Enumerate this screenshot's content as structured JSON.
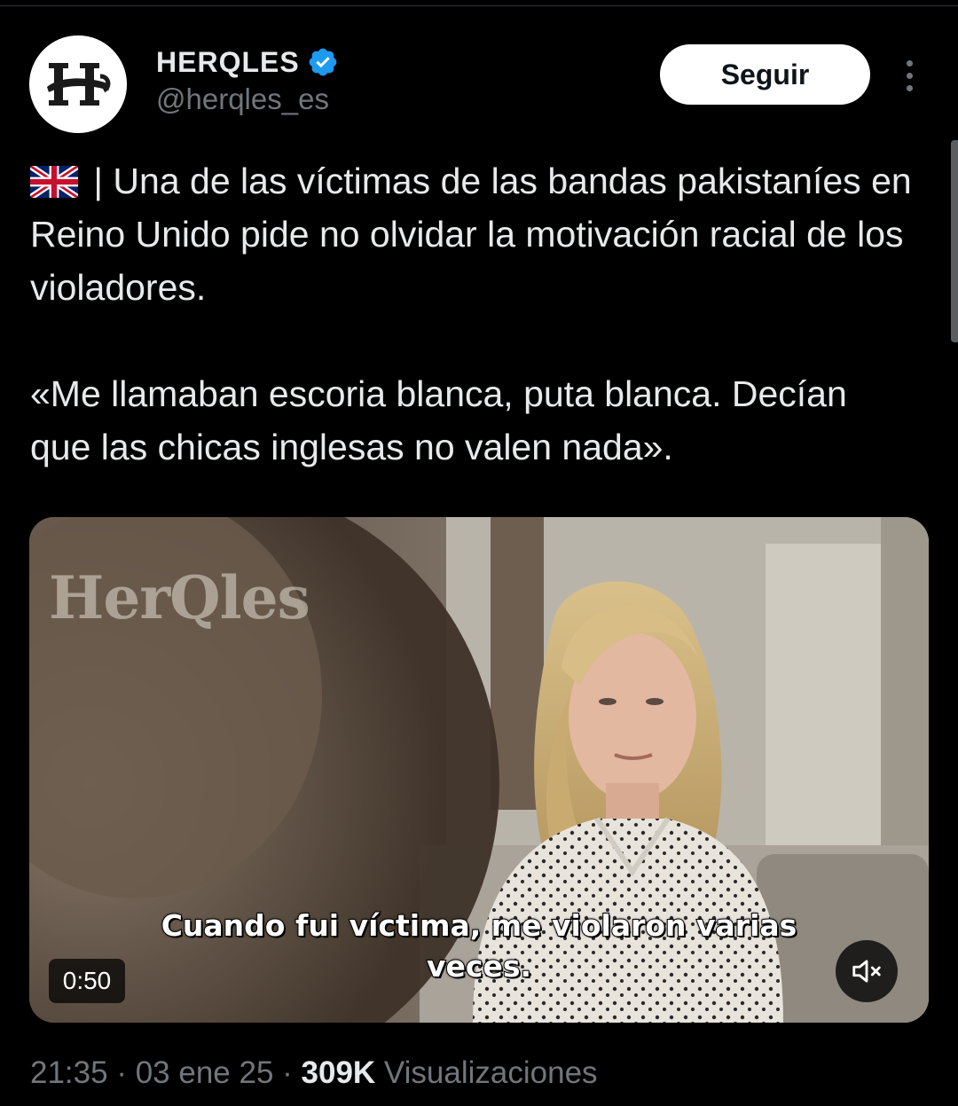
{
  "author": {
    "display_name": "HERQLES",
    "handle": "@herqles_es",
    "verified": true,
    "avatar_icon": "herqles-logo-icon"
  },
  "actions": {
    "follow_label": "Seguir",
    "more_icon": "more-options-icon"
  },
  "tweet": {
    "flag_icon": "uk-flag-icon",
    "paragraph1": " | Una de las víctimas de las bandas pakistaníes en Reino Unido pide no olvidar la motivación racial de los violadores.",
    "paragraph2": "«Me llamaban escoria blanca, puta blanca. Decían que las chicas inglesas no valen nada»."
  },
  "media": {
    "watermark": "HerQles",
    "subtitle_line1": "Cuando fui víctima, me violaron varias",
    "subtitle_line2": "veces.",
    "duration": "0:50",
    "mute_icon": "volume-muted-icon"
  },
  "meta": {
    "time": "21:35",
    "separator1": " · ",
    "date": "03 ene 25",
    "separator2": " · ",
    "views_count": "309K",
    "views_label": " Visualizaciones"
  },
  "colors": {
    "background": "#000000",
    "text_primary": "#e7e9ea",
    "text_secondary": "#71767b",
    "verified_blue": "#1d9bf0",
    "follow_bg": "#ffffff"
  }
}
